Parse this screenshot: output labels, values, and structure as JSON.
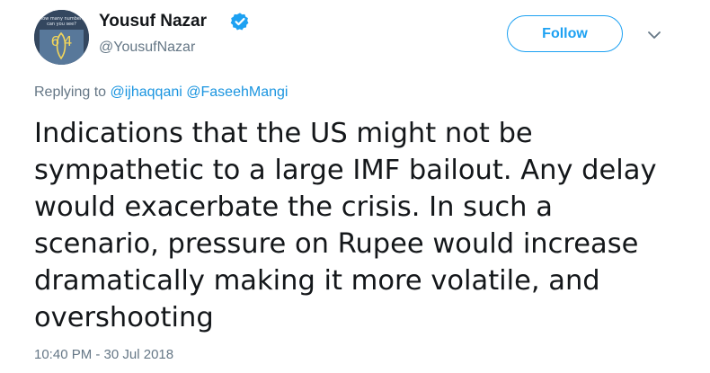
{
  "author": {
    "display_name": "Yousuf Nazar",
    "handle": "@YousufNazar",
    "verified_icon": "verified-badge-icon",
    "avatar_text": {
      "line1": "How many numbers",
      "line2": "can you see?",
      "digits": "6 4"
    }
  },
  "actions": {
    "follow_label": "Follow",
    "menu_icon": "chevron-down-icon"
  },
  "reply": {
    "prefix": "Replying to",
    "mentions": [
      "@ijhaqqani",
      "@FaseehMangi"
    ]
  },
  "tweet": {
    "lines": [
      "Indications that the US might not be",
      "sympathetic to a large IMF bailout. Any delay",
      "would exacerbate the crisis. In such a",
      "scenario, pressure on Rupee would increase",
      "dramatically making it more volatile, and",
      "overshooting"
    ]
  },
  "meta": {
    "timestamp": "10:40 PM - 30 Jul 2018"
  },
  "colors": {
    "accent": "#1da1f2",
    "mention": "#1b95e0",
    "secondary_text": "#657786",
    "primary_text": "#14171a"
  }
}
